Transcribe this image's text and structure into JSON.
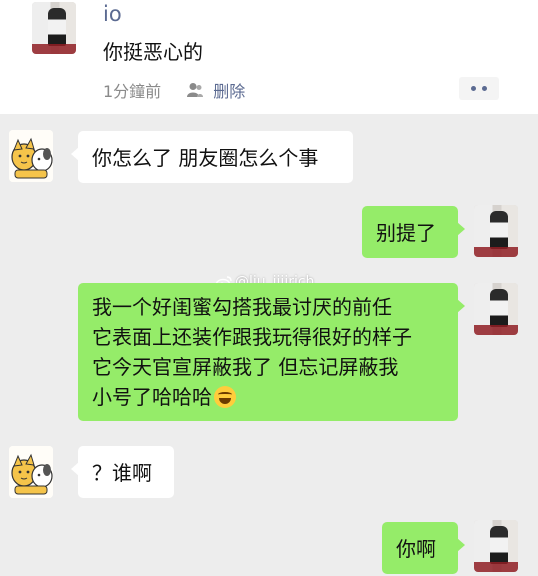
{
  "moment": {
    "name": "io",
    "text": "你挺恶心的",
    "time": "1分鐘前",
    "delete_label": "删除"
  },
  "messages": [
    {
      "side": "left",
      "text": "你怎么了 朋友圈怎么个事"
    },
    {
      "side": "right",
      "text": "别提了"
    },
    {
      "side": "right",
      "lines": [
        "我一个好闺蜜勾搭我最讨厌的前任",
        "它表面上还装作跟我玩得很好的样子",
        "它今天官宣屏蔽我了 但忘记屏蔽我",
        "小号了哈哈哈"
      ],
      "emoji": "laughing-crying-emoji"
    },
    {
      "side": "left",
      "text": "？谁啊"
    },
    {
      "side": "right",
      "text": "你啊"
    }
  ],
  "watermark": "@liu_iiiirich",
  "colors": {
    "green_bubble": "#95ec69",
    "link_blue": "#5b6a91",
    "background": "#ededed"
  }
}
